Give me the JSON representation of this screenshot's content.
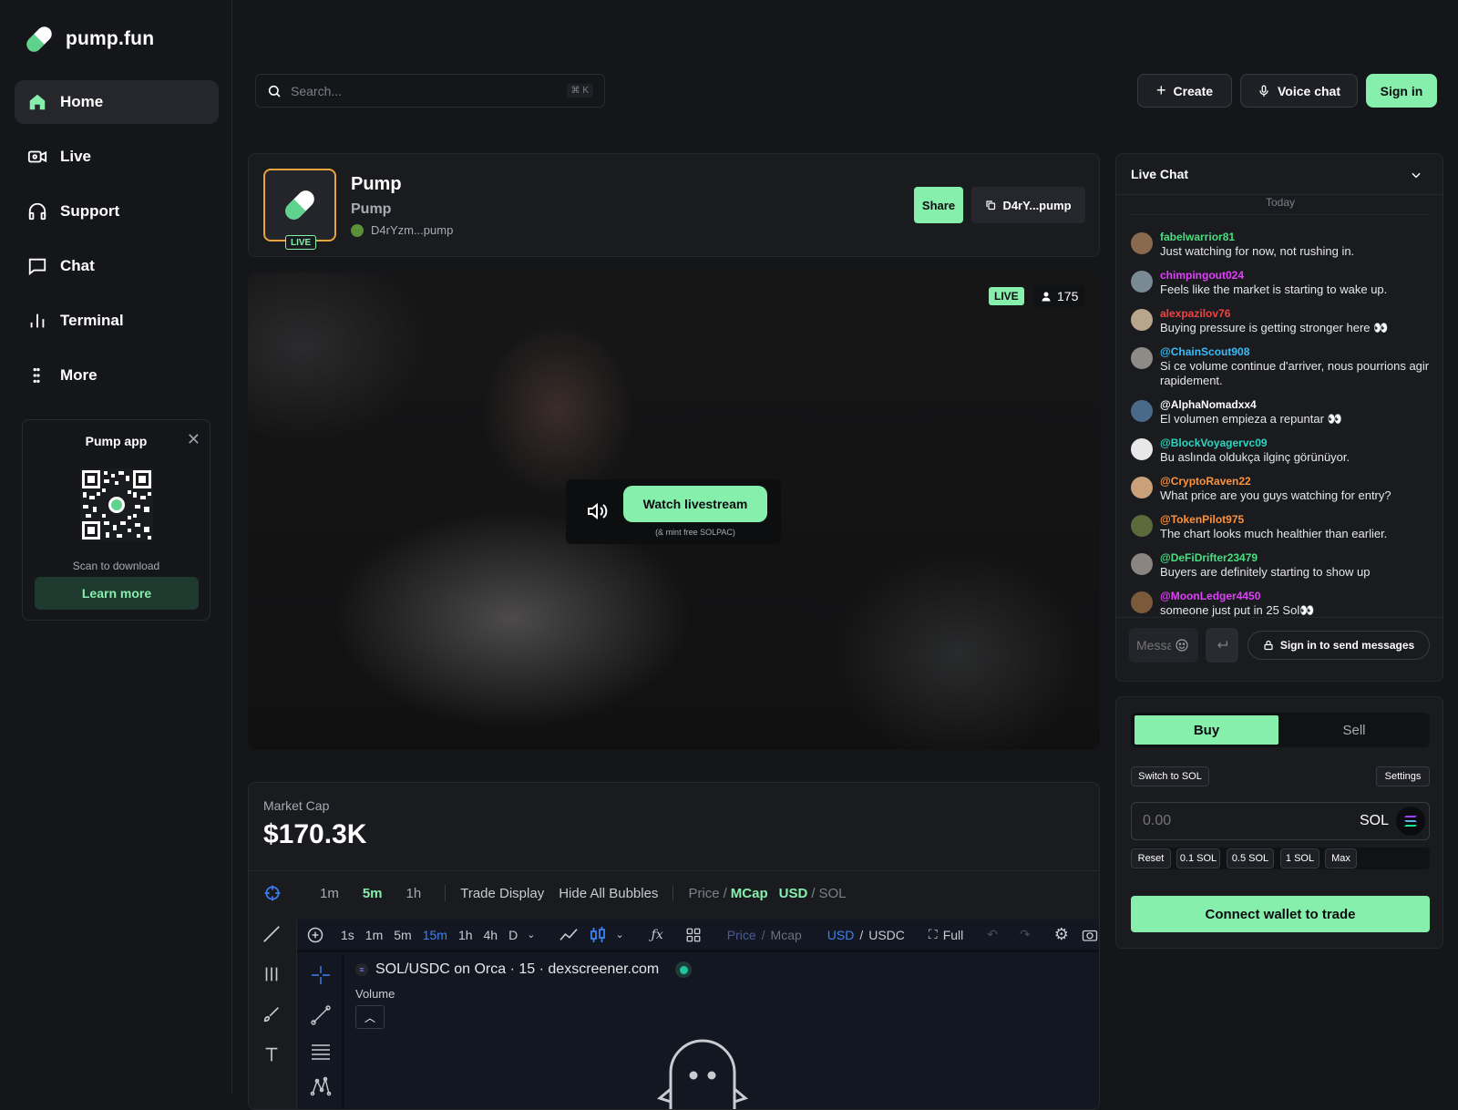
{
  "brand": {
    "name": "pump.fun"
  },
  "sidebar": {
    "items": [
      {
        "label": "Home",
        "icon": "home-icon"
      },
      {
        "label": "Live",
        "icon": "live-camera-icon"
      },
      {
        "label": "Support",
        "icon": "headphones-icon"
      },
      {
        "label": "Chat",
        "icon": "chat-bubble-icon"
      },
      {
        "label": "Terminal",
        "icon": "bar-chart-icon"
      },
      {
        "label": "More",
        "icon": "more-dots-icon"
      }
    ],
    "app_card": {
      "title": "Pump app",
      "scan_text": "Scan to download",
      "learn_label": "Learn more"
    }
  },
  "header": {
    "search_placeholder": "Search...",
    "search_shortcut": "⌘ K",
    "create_label": "Create",
    "voice_label": "Voice chat",
    "signin_label": "Sign in"
  },
  "token": {
    "name": "Pump",
    "ticker": "Pump",
    "creator": "D4rYzm...pump",
    "live_tag": "LIVE",
    "share_label": "Share",
    "address_label": "D4rY...pump"
  },
  "stream": {
    "live_badge": "LIVE",
    "viewers": "175",
    "watch_label": "Watch livestream",
    "watch_sub": "(& mint free SOLPAC)"
  },
  "market": {
    "label": "Market Cap",
    "value": "$170.3K",
    "intervals": [
      "1m",
      "5m",
      "1h"
    ],
    "active_interval": "5m",
    "trade_display": "Trade Display",
    "hide_bubbles": "Hide All Bubbles",
    "price": "Price",
    "mcap": "MCap",
    "usd": "USD",
    "sol": "SOL"
  },
  "chart_toolbar": {
    "timeframes": [
      "1s",
      "1m",
      "5m",
      "15m",
      "1h",
      "4h",
      "D"
    ],
    "active_timeframe": "15m",
    "price_label": "Price",
    "mcap_label": "Mcap",
    "usd_label": "USD",
    "usdc_label": "USDC",
    "full_label": "Full",
    "pair_title": "SOL/USDC on Orca · 15 · dexscreener.com",
    "volume_label": "Volume"
  },
  "live_chat": {
    "title": "Live Chat",
    "date_divider": "Today",
    "messages": [
      {
        "user": "fabelwarrior81",
        "text": "Just watching for now, not rushing in.",
        "color": "#4ade80"
      },
      {
        "user": "chimpingout024",
        "text": "Feels like the market is starting to wake up.",
        "color": "#e040fb"
      },
      {
        "user": "alexpazilov76",
        "text": "Buying pressure is getting stronger here 👀",
        "color": "#ef4444"
      },
      {
        "user": "@ChainScout908",
        "text": "Si ce volume continue d'arriver, nous pourrions agir rapidement.",
        "color": "#38bdf8"
      },
      {
        "user": "@AlphaNomadxx4",
        "text": "El volumen empieza a repuntar 👀",
        "color": "#ffffff"
      },
      {
        "user": "@BlockVoyagervc09",
        "text": "Bu aslında oldukça ilginç görünüyor.",
        "color": "#2dd4bf"
      },
      {
        "user": "@CryptoRaven22",
        "text": "What price are you guys watching for entry?",
        "color": "#fb923c"
      },
      {
        "user": "@TokenPilot975",
        "text": "The chart looks much healthier than earlier.",
        "color": "#fb923c"
      },
      {
        "user": "@DeFiDrifter23479",
        "text": "Buyers are definitely starting to show up",
        "color": "#4ade80"
      },
      {
        "user": "@MoonLedger4450",
        "text": "someone just put in 25 Sol👀",
        "color": "#e040fb"
      }
    ],
    "input_placeholder": "Message",
    "signin_send_label": "Sign in to send messages"
  },
  "trade": {
    "buy_label": "Buy",
    "sell_label": "Sell",
    "switch_label": "Switch to SOL",
    "settings_label": "Settings",
    "amount_placeholder": "0.00",
    "currency": "SOL",
    "quick": [
      "Reset",
      "0.1 SOL",
      "0.5 SOL",
      "1 SOL",
      "Max"
    ],
    "connect_label": "Connect wallet to trade"
  },
  "colors": {
    "accent": "#86efac",
    "bg": "#15161a",
    "panel": "#1a1b1f"
  }
}
